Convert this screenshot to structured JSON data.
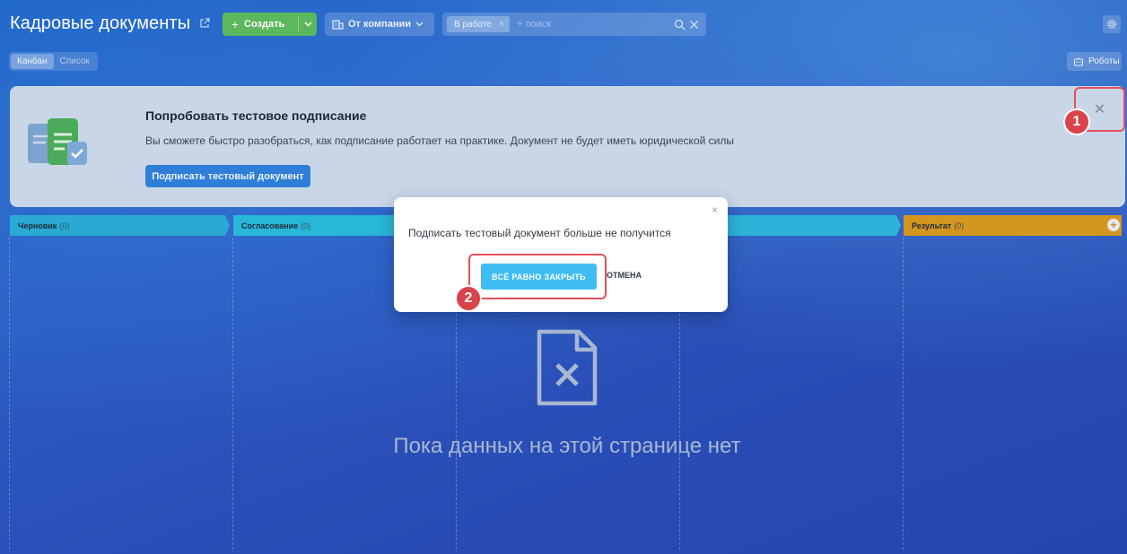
{
  "header": {
    "title": "Кадровые документы",
    "create_label": "Создать",
    "company_label": "От компании",
    "filter_chip": "В работе",
    "search_placeholder": "+ поиск"
  },
  "view_switch": {
    "kanban": "Канбан",
    "list": "Список"
  },
  "robots_label": "Роботы",
  "banner": {
    "title": "Попробовать тестовое подписание",
    "description": "Вы сможете быстро разобраться, как подписание работает на практике. Документ не будет иметь юридической силы",
    "button": "Подписать тестовый документ",
    "close_symbol": "✕"
  },
  "columns": [
    {
      "name": "Черновик",
      "count": "(0)",
      "color": "#29a9d3"
    },
    {
      "name": "Согласование",
      "count": "(0)",
      "color": "#29b7d8"
    },
    {
      "name": "",
      "count": "",
      "color": "#2db3d9"
    },
    {
      "name": "Результат",
      "count": "(0)",
      "color": "#d5961f"
    }
  ],
  "empty_state": {
    "text": "Пока данных на этой странице нет"
  },
  "modal": {
    "message": "Подписать тестовый документ больше не получится",
    "confirm": "ВСЁ РАВНО ЗАКРЫТЬ",
    "cancel": "ОТМЕНА",
    "close_symbol": "×"
  },
  "markers": {
    "first": "1",
    "second": "2"
  },
  "colors": {
    "accent_red": "#e5515a",
    "create_green": "#5cb85c",
    "confirm_blue": "#3fbdf2"
  }
}
